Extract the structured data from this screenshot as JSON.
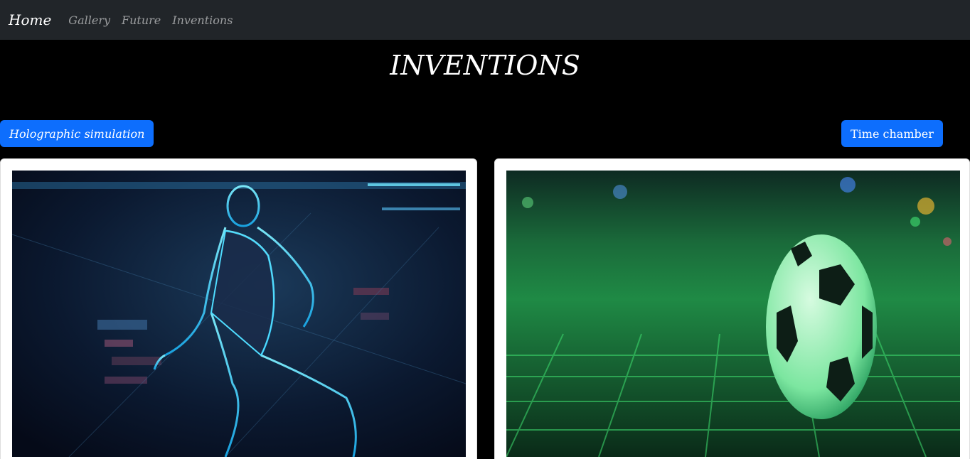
{
  "nav": {
    "brand": "Home",
    "links": [
      "Gallery",
      "Future",
      "Inventions"
    ]
  },
  "page": {
    "title": "INVENTIONS"
  },
  "buttons": {
    "left_label": "Holographic simulation",
    "right_label": "Time chamber"
  },
  "colors": {
    "navbar": "#212529",
    "background": "#000000",
    "button": "#0d6efd"
  },
  "images": {
    "left_icon": "holographic-player-image",
    "right_icon": "digital-soccer-ball-image"
  }
}
